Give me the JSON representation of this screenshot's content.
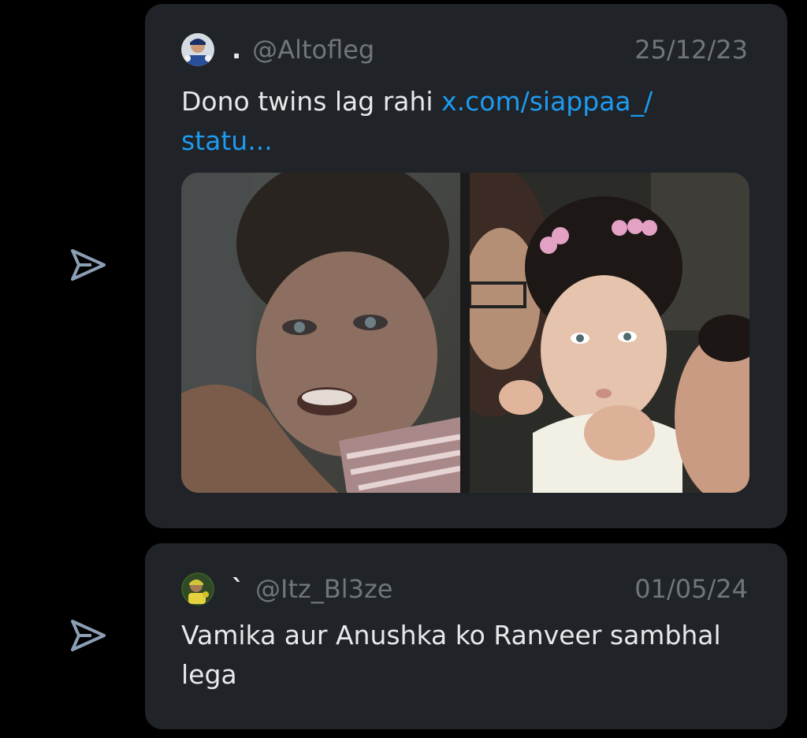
{
  "thread": [
    {
      "display_name": ".",
      "handle": "@Altofleg",
      "date": "25/12/23",
      "text": "Dono twins lag rahi ",
      "link": "x.com/siappaa_/ statu...",
      "media": {
        "left_image": "baby-photo-left",
        "right_image": "baby-photo-right"
      },
      "avatar_icon": "cricket-avatar-icon",
      "send_icon": "send-icon"
    },
    {
      "display_name": "`",
      "handle": "@Itz_Bl3ze",
      "date": "01/05/24",
      "text": "Vamika aur Anushka ko Ranveer sambhal lega",
      "avatar_icon": "cricket-avatar-icon",
      "send_icon": "send-icon"
    }
  ],
  "colors": {
    "background": "#000000",
    "card": "#202327",
    "text_primary": "#e7e9ea",
    "text_secondary": "#71767b",
    "link": "#1d9bf0",
    "send_icon": "#8b9fb5"
  }
}
